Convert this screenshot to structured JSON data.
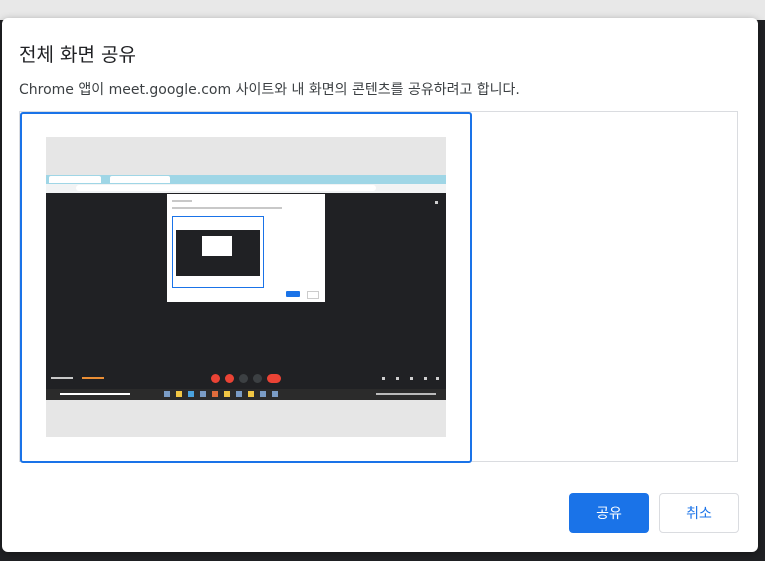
{
  "dialog": {
    "title": "전체 화면 공유",
    "description": "Chrome 앱이 meet.google.com 사이트와 내 화면의 콘텐츠를 공유하려고 합니다.",
    "share_label": "공유",
    "cancel_label": "취소"
  },
  "colors": {
    "accent": "#1a73e8",
    "meet_background": "#202124",
    "end_call_red": "#ea4335"
  },
  "icons": [
    "screen-preview-thumbnail"
  ]
}
